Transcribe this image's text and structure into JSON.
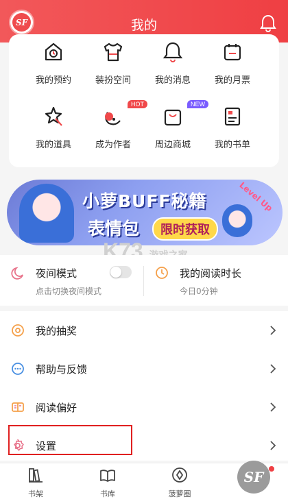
{
  "header": {
    "title": "我的",
    "logo_text": "SF"
  },
  "grid": [
    {
      "label": "我的预约",
      "icon": "calendar-clock-icon",
      "badge": ""
    },
    {
      "label": "装扮空间",
      "icon": "shirt-icon",
      "badge": ""
    },
    {
      "label": "我的消息",
      "icon": "bell-icon",
      "badge": ""
    },
    {
      "label": "我的月票",
      "icon": "ticket-icon",
      "badge": ""
    },
    {
      "label": "我的道具",
      "icon": "wand-icon",
      "badge": ""
    },
    {
      "label": "成为作者",
      "icon": "pen-author-icon",
      "badge": "HOT"
    },
    {
      "label": "周边商城",
      "icon": "shopping-bag-icon",
      "badge": "NEW"
    },
    {
      "label": "我的书单",
      "icon": "booklist-icon",
      "badge": ""
    }
  ],
  "banner": {
    "line1": "小萝BUFF秘籍",
    "line2": "表情包",
    "pill": "限时获取",
    "corner": "Level Up"
  },
  "quick": {
    "night": {
      "title": "夜间模式",
      "subtitle": "点击切换夜间模式",
      "enabled": false
    },
    "read": {
      "title": "我的阅读时长",
      "subtitle": "今日0分钟"
    }
  },
  "menu": [
    {
      "label": "我的抽奖",
      "icon": "lottery-icon"
    },
    {
      "label": "帮助与反馈",
      "icon": "chat-help-icon"
    },
    {
      "label": "阅读偏好",
      "icon": "reading-pref-icon"
    },
    {
      "label": "设置",
      "icon": "gear-icon"
    }
  ],
  "tabs": [
    {
      "label": "书架",
      "icon": "bookshelf-icon"
    },
    {
      "label": "书库",
      "icon": "library-icon"
    },
    {
      "label": "菠萝圈",
      "icon": "community-icon"
    }
  ],
  "watermark": {
    "main": "K73",
    "sub": "游戏之家"
  },
  "colors": {
    "accent": "#ef3f43",
    "icon_orange": "#f5a04a",
    "icon_blue": "#4a90e2",
    "icon_pink": "#e8728a"
  }
}
